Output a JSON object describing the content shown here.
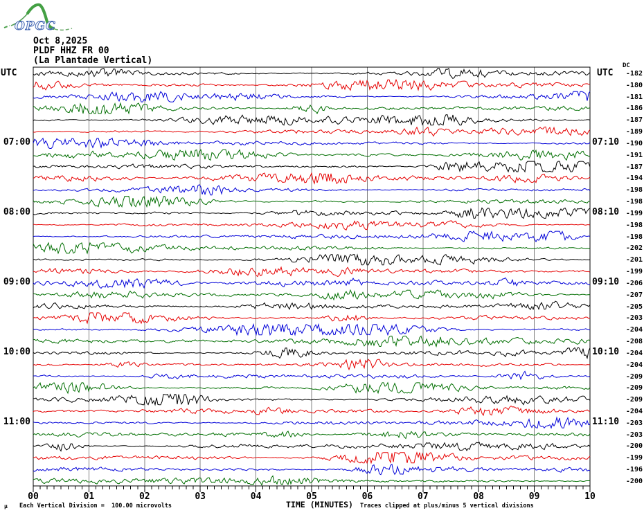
{
  "logo": {
    "text": "OPGC"
  },
  "header": {
    "date": "Oct 8,2025",
    "station_code": "PLDF HHZ FR 00",
    "station_name": "(La Plantade Vertical)"
  },
  "axes": {
    "left_utc": "UTC",
    "right_utc": "UTC",
    "dc_header": "DC",
    "x_axis_label": "TIME (MINUTES)",
    "x_tick_labels": [
      "00",
      "01",
      "02",
      "03",
      "04",
      "05",
      "06",
      "07",
      "08",
      "09",
      "10"
    ]
  },
  "footer": {
    "mu_mark": "μ",
    "scale_note": "Each Vertical Division =  100.00 microvolts",
    "clip_note": "Traces clipped at plus/minus 5 vertical divisions"
  },
  "colors": {
    "trace_cycle": [
      "#000000",
      "#e60000",
      "#0000d8",
      "#006e00"
    ],
    "grid": "#808080",
    "border": "#000000",
    "logo_green": "#4aa04a",
    "logo_blue": "#3a5fae"
  },
  "chart_data": {
    "type": "line",
    "subtype": "helicorder-seismogram",
    "title": "PLDF HHZ FR 00 (La Plantade Vertical) — Oct 8,2025",
    "xlabel": "TIME (MINUTES)",
    "x_range_minutes": [
      0,
      10
    ],
    "minutes_per_row": 10,
    "rows_count": 36,
    "first_row_start_utc": "06:00",
    "waveform_note": "ambient seismic noise traces, clipped at ±5 vertical divisions; DC column gives per-row mean offset in microvolts",
    "rows": [
      {
        "start_utc": "06:00",
        "left_label": "",
        "right_label": "",
        "dc": -182,
        "color_index": 0
      },
      {
        "start_utc": "06:10",
        "left_label": "",
        "right_label": "",
        "dc": -180,
        "color_index": 1
      },
      {
        "start_utc": "06:20",
        "left_label": "",
        "right_label": "",
        "dc": -181,
        "color_index": 2
      },
      {
        "start_utc": "06:30",
        "left_label": "",
        "right_label": "",
        "dc": -186,
        "color_index": 3
      },
      {
        "start_utc": "06:40",
        "left_label": "",
        "right_label": "",
        "dc": -187,
        "color_index": 0
      },
      {
        "start_utc": "06:50",
        "left_label": "",
        "right_label": "",
        "dc": -189,
        "color_index": 1
      },
      {
        "start_utc": "07:00",
        "left_label": "07:00",
        "right_label": "07:10",
        "dc": -190,
        "color_index": 2
      },
      {
        "start_utc": "07:10",
        "left_label": "",
        "right_label": "",
        "dc": -191,
        "color_index": 3
      },
      {
        "start_utc": "07:20",
        "left_label": "",
        "right_label": "",
        "dc": -187,
        "color_index": 0
      },
      {
        "start_utc": "07:30",
        "left_label": "",
        "right_label": "",
        "dc": -194,
        "color_index": 1
      },
      {
        "start_utc": "07:40",
        "left_label": "",
        "right_label": "",
        "dc": -198,
        "color_index": 2
      },
      {
        "start_utc": "07:50",
        "left_label": "",
        "right_label": "",
        "dc": -198,
        "color_index": 3
      },
      {
        "start_utc": "08:00",
        "left_label": "08:00",
        "right_label": "08:10",
        "dc": -199,
        "color_index": 0
      },
      {
        "start_utc": "08:10",
        "left_label": "",
        "right_label": "",
        "dc": -198,
        "color_index": 1
      },
      {
        "start_utc": "08:20",
        "left_label": "",
        "right_label": "",
        "dc": -198,
        "color_index": 2
      },
      {
        "start_utc": "08:30",
        "left_label": "",
        "right_label": "",
        "dc": -202,
        "color_index": 3
      },
      {
        "start_utc": "08:40",
        "left_label": "",
        "right_label": "",
        "dc": -201,
        "color_index": 0
      },
      {
        "start_utc": "08:50",
        "left_label": "",
        "right_label": "",
        "dc": -199,
        "color_index": 1
      },
      {
        "start_utc": "09:00",
        "left_label": "09:00",
        "right_label": "09:10",
        "dc": -206,
        "color_index": 2
      },
      {
        "start_utc": "09:10",
        "left_label": "",
        "right_label": "",
        "dc": -207,
        "color_index": 3
      },
      {
        "start_utc": "09:20",
        "left_label": "",
        "right_label": "",
        "dc": -205,
        "color_index": 0
      },
      {
        "start_utc": "09:30",
        "left_label": "",
        "right_label": "",
        "dc": -203,
        "color_index": 1
      },
      {
        "start_utc": "09:40",
        "left_label": "",
        "right_label": "",
        "dc": -204,
        "color_index": 2
      },
      {
        "start_utc": "09:50",
        "left_label": "",
        "right_label": "",
        "dc": -208,
        "color_index": 3
      },
      {
        "start_utc": "10:00",
        "left_label": "10:00",
        "right_label": "10:10",
        "dc": -204,
        "color_index": 0
      },
      {
        "start_utc": "10:10",
        "left_label": "",
        "right_label": "",
        "dc": -204,
        "color_index": 1
      },
      {
        "start_utc": "10:20",
        "left_label": "",
        "right_label": "",
        "dc": -209,
        "color_index": 2
      },
      {
        "start_utc": "10:30",
        "left_label": "",
        "right_label": "",
        "dc": -209,
        "color_index": 3
      },
      {
        "start_utc": "10:40",
        "left_label": "",
        "right_label": "",
        "dc": -209,
        "color_index": 0
      },
      {
        "start_utc": "10:50",
        "left_label": "",
        "right_label": "",
        "dc": -204,
        "color_index": 1
      },
      {
        "start_utc": "11:00",
        "left_label": "11:00",
        "right_label": "11:10",
        "dc": -203,
        "color_index": 2
      },
      {
        "start_utc": "11:10",
        "left_label": "",
        "right_label": "",
        "dc": -203,
        "color_index": 3
      },
      {
        "start_utc": "11:20",
        "left_label": "",
        "right_label": "",
        "dc": -200,
        "color_index": 0
      },
      {
        "start_utc": "11:30",
        "left_label": "",
        "right_label": "",
        "dc": -199,
        "color_index": 1
      },
      {
        "start_utc": "11:40",
        "left_label": "",
        "right_label": "",
        "dc": -196,
        "color_index": 2
      },
      {
        "start_utc": "11:50",
        "left_label": "",
        "right_label": "",
        "dc": -200,
        "color_index": 3
      }
    ]
  }
}
